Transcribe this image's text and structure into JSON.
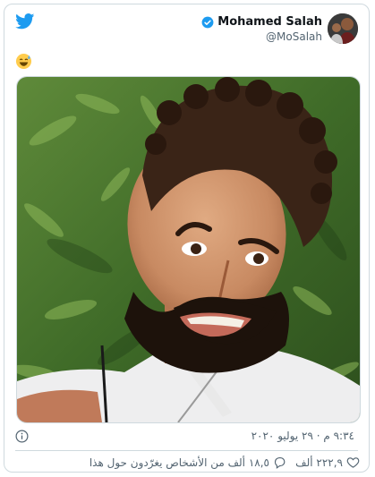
{
  "tweet": {
    "author": {
      "display_name": "Mohamed Salah",
      "handle": "@MoSalah",
      "verified": true
    },
    "text_emoji": "grinning-sweat-emoji",
    "timestamp": "٩:٣٤ م · ٢٩ يوليو ٢٠٢٠",
    "likes_label": "٢٢٢,٩ ألف",
    "replies_label": "١٨,٥ ألف من الأشخاص يغرّدون حول هذا"
  },
  "icons": {
    "brand": "twitter-bird-icon",
    "verified": "verified-badge-icon",
    "info": "info-icon",
    "heart": "heart-icon",
    "reply": "reply-icon"
  },
  "colors": {
    "twitter_blue": "#1d9bf0",
    "secondary_text": "#536471",
    "border": "#cfd9de"
  }
}
